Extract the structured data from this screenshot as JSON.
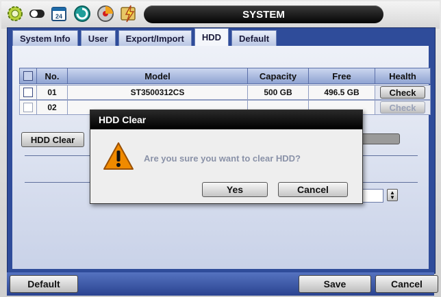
{
  "window": {
    "title": "SYSTEM"
  },
  "top_icons": [
    "gear-icon",
    "toggle-icon",
    "calendar-icon",
    "network-globe-icon",
    "record-disc-icon",
    "event-lightning-icon"
  ],
  "calendar_day": "24",
  "tabs": [
    {
      "label": "System Info",
      "active": false
    },
    {
      "label": "User",
      "active": false
    },
    {
      "label": "Export/Import",
      "active": false
    },
    {
      "label": "HDD",
      "active": true
    },
    {
      "label": "Default",
      "active": false
    }
  ],
  "table": {
    "columns": [
      "No.",
      "Model",
      "Capacity",
      "Free",
      "Health"
    ],
    "rows": [
      {
        "no": "01",
        "model": "ST3500312CS",
        "capacity": "500 GB",
        "free": "496.5 GB",
        "health_button": "Check",
        "enabled": true
      },
      {
        "no": "02",
        "model": "",
        "capacity": "",
        "free": "",
        "health_button": "Check",
        "enabled": false
      }
    ]
  },
  "hdd_clear_button": "HDD Clear",
  "dialog": {
    "title": "HDD Clear",
    "message": "Are you sure you want to clear HDD?",
    "yes_label": "Yes",
    "cancel_label": "Cancel"
  },
  "bottom": {
    "default_label": "Default",
    "save_label": "Save",
    "cancel_label": "Cancel"
  },
  "colors": {
    "panel_blue": "#2f4c9a",
    "title_black": "#000000",
    "warning_orange": "#f08a00"
  }
}
